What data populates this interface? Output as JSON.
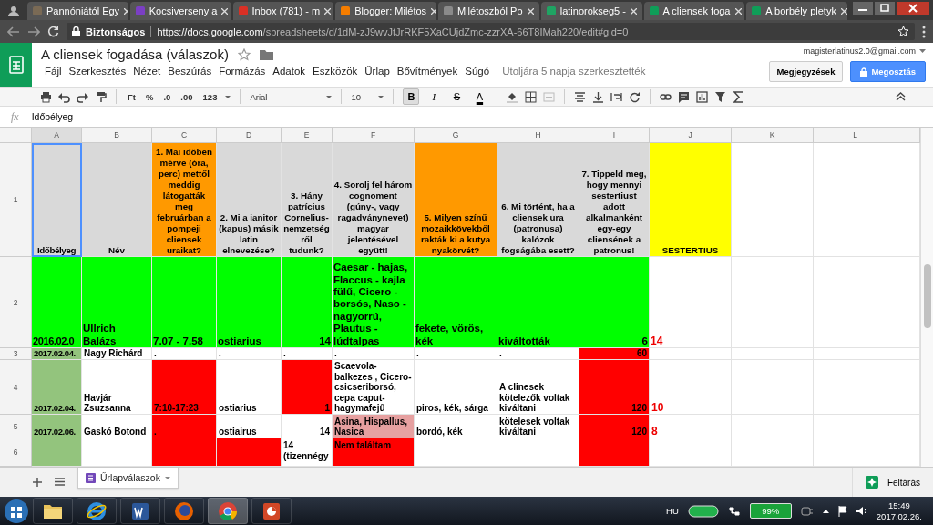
{
  "browser": {
    "tabs": [
      {
        "label": "Pannóniától Egy",
        "color": "#7a6a55"
      },
      {
        "label": "Kocsiverseny a",
        "color": "#7b3fc4"
      },
      {
        "label": "Inbox (781) - m",
        "color": "#d93025"
      },
      {
        "label": "Blogger: Milétos",
        "color": "#f57d00"
      },
      {
        "label": "Milétoszból Po",
        "color": "#8a8a8a"
      },
      {
        "label": "latinorokseg5 -",
        "color": "#1fa463"
      },
      {
        "label": "A cliensek foga",
        "color": "#0f9d58"
      },
      {
        "label": "A borbély pletyk",
        "color": "#0f9d58"
      }
    ],
    "security": "Biztonságos",
    "url_host": "https://docs.google.com",
    "url_path": "/spreadsheets/d/1dM-zJ9wvJtJrRKF5XaCUjdZmc-zzrXA-66T8IMah220/edit#gid=0"
  },
  "document": {
    "title": "A cliensek fogadása (válaszok)",
    "menus": [
      "Fájl",
      "Szerkesztés",
      "Nézet",
      "Beszúrás",
      "Formázás",
      "Adatok",
      "Eszközök",
      "Űrlap",
      "Bővítmények",
      "Súgó"
    ],
    "last_edit": "Utoljára 5 napja szerkesztették",
    "account": "magisterlatinus2.0@gmail.com",
    "comments_button": "Megjegyzések",
    "share_button": "Megosztás"
  },
  "toolbar": {
    "format_buttons": [
      "Ft",
      "%",
      ".0",
      ".00",
      "123"
    ],
    "font": "Arial",
    "size": "10",
    "style_buttons": [
      {
        "label": "B",
        "selected": true
      },
      {
        "label": "I",
        "selected": false
      },
      {
        "label": "S",
        "selected": false
      },
      {
        "label": "A",
        "selected": false
      }
    ]
  },
  "formula_bar": {
    "label": "fx",
    "value": "Időbélyeg"
  },
  "sheet": {
    "columns": [
      {
        "label": "A",
        "selected": true
      },
      {
        "label": "B",
        "selected": false
      },
      {
        "label": "C",
        "selected": false
      },
      {
        "label": "D",
        "selected": false
      },
      {
        "label": "E",
        "selected": false
      },
      {
        "label": "F",
        "selected": false
      },
      {
        "label": "G",
        "selected": false
      },
      {
        "label": "H",
        "selected": false
      },
      {
        "label": "I",
        "selected": false
      },
      {
        "label": "J",
        "selected": false
      },
      {
        "label": "K",
        "selected": false
      },
      {
        "label": "L",
        "selected": false
      }
    ],
    "rows": [
      {
        "number": "1",
        "kind": "question",
        "cells": [
          {
            "text": "Időbélyeg",
            "color": "#d9d9d9",
            "selected": true
          },
          {
            "text": "Név",
            "color": "#d9d9d9",
            "selected": false
          },
          {
            "text": "1. Mai időben mérve (óra, perc) mettől meddig látogatták meg februárban a pompeji cliensek uraikat?",
            "color": "#ff9900",
            "selected": false
          },
          {
            "text": "2. Mi a ianitor (kapus) másik latin elnevezése?",
            "color": "#d9d9d9",
            "selected": false
          },
          {
            "text": "3. Hány patrícius Cornelius-nemzetség ről tudunk?",
            "color": "#d9d9d9",
            "selected": false
          },
          {
            "text": "4. Sorolj fel három cognoment (gúny-, vagy ragadványnevet) magyar jelentésével együtt!",
            "color": "#d9d9d9",
            "selected": false
          },
          {
            "text": "5. Milyen színű mozaikkövekből rakták ki a kutya nyakörvét?",
            "color": "#ff9900",
            "selected": false
          },
          {
            "text": "6. Mi történt, ha a cliensek ura (patronusa) kalózok fogságába esett?",
            "color": "#d9d9d9",
            "selected": false
          },
          {
            "text": "7. Tippeld meg, hogy mennyi sestertiust adott alkalmanként egy-egy cliensének a patronus!",
            "color": "#d9d9d9",
            "selected": false
          },
          {
            "text": "SESTERTIUS",
            "color": "#ffff00",
            "selected": false
          }
        ]
      },
      {
        "number": "2",
        "kind": "first",
        "cells": [
          {
            "text": "2016.02.0",
            "color": "#00ff00"
          },
          {
            "text": "Ullrich Balázs",
            "color": "#00ff00"
          },
          {
            "text": "7.07 - 7.58",
            "color": "#00ff00"
          },
          {
            "text": "ostiarius",
            "color": "#00ff00"
          },
          {
            "text": "14",
            "color": "#00ff00",
            "kind": "number"
          },
          {
            "text": "Caesar - hajas, Flaccus - kajla fülű, Cicero - borsós, Naso - nagyorrú, Plautus - lúdtalpas",
            "color": "#00ff00"
          },
          {
            "text": "fekete, vörös, kék",
            "color": "#00ff00"
          },
          {
            "text": "kiváltották",
            "color": "#00ff00"
          },
          {
            "text": "6",
            "color": "#00ff00",
            "kind": "number"
          },
          {
            "text": "14",
            "kind": "mark"
          }
        ]
      },
      {
        "number": "3",
        "kind": "entry",
        "cells": [
          {
            "text": "2017.02.04.",
            "color": "#93c47d"
          },
          {
            "text": "Nagy Richárd"
          },
          {
            "text": "."
          },
          {
            "text": "."
          },
          {
            "text": "."
          },
          {
            "text": "."
          },
          {
            "text": "."
          },
          {
            "text": "."
          },
          {
            "text": "60",
            "color": "#ff0000",
            "kind": "number"
          },
          {}
        ]
      },
      {
        "number": "4",
        "kind": "entry",
        "cells": [
          {
            "text": "2017.02.04.",
            "color": "#93c47d"
          },
          {
            "text": "Havjár Zsuzsanna"
          },
          {
            "text": "7:10-17:23",
            "color": "#ff0000"
          },
          {
            "text": "ostiarius"
          },
          {
            "text": "1",
            "color": "#ff0000",
            "kind": "number"
          },
          {
            "text": "Scaevola-balkezes , Cicero-csicseriborsó, cepa caput-hagymafejű"
          },
          {
            "text": "piros, kék, sárga"
          },
          {
            "text": "A clinesek kötelezők voltak kiváltani"
          },
          {
            "text": "120",
            "color": "#ff0000",
            "kind": "number"
          },
          {
            "text": "10",
            "kind": "mark"
          }
        ]
      },
      {
        "number": "5",
        "kind": "entry",
        "cells": [
          {
            "text": "2017.02.06.",
            "color": "#93c47d"
          },
          {
            "text": "Gaskó Botond"
          },
          {
            "text": ".",
            "color": "#ff0000"
          },
          {
            "text": "ostiairus"
          },
          {
            "text": "14",
            "kind": "number"
          },
          {
            "text": "Asina, Hispallus, Nasica",
            "color": "#e6a0a0"
          },
          {
            "text": "bordó, kék"
          },
          {
            "text": "kötelesek voltak kiváltani"
          },
          {
            "text": "120",
            "color": "#ff0000",
            "kind": "number"
          },
          {
            "text": "8",
            "kind": "mark"
          }
        ]
      },
      {
        "number": "6",
        "kind": "cut",
        "cells": [
          {
            "color": "#93c47d"
          },
          {},
          {
            "color": "#ff0000"
          },
          {
            "color": "#ff0000"
          },
          {
            "text": "14 (tizennégy"
          },
          {
            "text": "Nem találtam",
            "color": "#ff0000"
          },
          {},
          {},
          {
            "color": "#ff0000"
          },
          {}
        ]
      }
    ]
  },
  "sheet_tabs": {
    "tabs": [
      {
        "label": "Űrlapválaszok",
        "selected": true
      }
    ],
    "explore_button": "Feltárás"
  },
  "taskbar": {
    "apps": [
      {
        "kind": "folder",
        "selected": false
      },
      {
        "kind": "ie",
        "selected": false
      },
      {
        "kind": "word",
        "selected": false
      },
      {
        "kind": "firefox",
        "selected": false
      },
      {
        "kind": "chrome",
        "selected": true
      },
      {
        "kind": "powerpoint",
        "selected": false
      }
    ],
    "language": "HU",
    "battery": "99%",
    "time": "15:49",
    "date": "2017.02.26."
  }
}
